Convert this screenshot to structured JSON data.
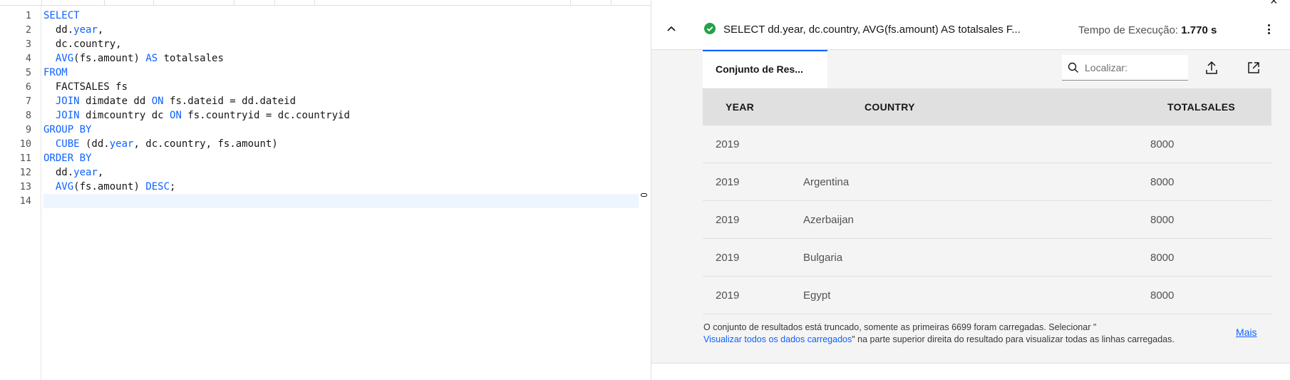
{
  "editor": {
    "line_numbers": [
      "1",
      "2",
      "3",
      "4",
      "5",
      "6",
      "7",
      "8",
      "9",
      "10",
      "11",
      "12",
      "13",
      "14"
    ],
    "lines": [
      [
        {
          "t": "SELECT",
          "k": "kw"
        }
      ],
      [
        {
          "t": "  dd.",
          "k": "id"
        },
        {
          "t": "year",
          "k": "kw"
        },
        {
          "t": ",",
          "k": "id"
        }
      ],
      [
        {
          "t": "  dc.country,",
          "k": "id"
        }
      ],
      [
        {
          "t": "  ",
          "k": "id"
        },
        {
          "t": "AVG",
          "k": "kw"
        },
        {
          "t": "(fs.amount) ",
          "k": "id"
        },
        {
          "t": "AS",
          "k": "kw"
        },
        {
          "t": " totalsales",
          "k": "id"
        }
      ],
      [
        {
          "t": "FROM",
          "k": "kw"
        }
      ],
      [
        {
          "t": "  FACTSALES fs",
          "k": "id"
        }
      ],
      [
        {
          "t": "  ",
          "k": "id"
        },
        {
          "t": "JOIN",
          "k": "kw"
        },
        {
          "t": " dimdate dd ",
          "k": "id"
        },
        {
          "t": "ON",
          "k": "kw"
        },
        {
          "t": " fs.dateid = dd.dateid",
          "k": "id"
        }
      ],
      [
        {
          "t": "  ",
          "k": "id"
        },
        {
          "t": "JOIN",
          "k": "kw"
        },
        {
          "t": " dimcountry dc ",
          "k": "id"
        },
        {
          "t": "ON",
          "k": "kw"
        },
        {
          "t": " fs.countryid = dc.countryid",
          "k": "id"
        }
      ],
      [
        {
          "t": "GROUP BY",
          "k": "kw"
        }
      ],
      [
        {
          "t": "  ",
          "k": "id"
        },
        {
          "t": "CUBE",
          "k": "kw"
        },
        {
          "t": " (dd.",
          "k": "id"
        },
        {
          "t": "year",
          "k": "kw"
        },
        {
          "t": ", dc.country, fs.amount)",
          "k": "id"
        }
      ],
      [
        {
          "t": "ORDER BY",
          "k": "kw"
        }
      ],
      [
        {
          "t": "  dd.",
          "k": "id"
        },
        {
          "t": "year",
          "k": "kw"
        },
        {
          "t": ",",
          "k": "id"
        }
      ],
      [
        {
          "t": "  ",
          "k": "id"
        },
        {
          "t": "AVG",
          "k": "kw"
        },
        {
          "t": "(fs.amount) ",
          "k": "id"
        },
        {
          "t": "DESC",
          "k": "kw"
        },
        {
          "t": ";",
          "k": "id"
        }
      ],
      []
    ]
  },
  "results": {
    "query_summary": "SELECT dd.year, dc.country, AVG(fs.amount) AS totalsales F...",
    "exec_time_label": "Tempo de Execução:",
    "exec_time_value": "1.770 s",
    "close_glyph": "×",
    "tab_label": "Conjunto de Res...",
    "search_placeholder": "Localizar:",
    "columns": [
      "YEAR",
      "COUNTRY",
      "TOTALSALES"
    ],
    "rows": [
      [
        "2019",
        "",
        "8000"
      ],
      [
        "2019",
        "Argentina",
        "8000"
      ],
      [
        "2019",
        "Azerbaijan",
        "8000"
      ],
      [
        "2019",
        "Bulgaria",
        "8000"
      ],
      [
        "2019",
        "Egypt",
        "8000"
      ]
    ],
    "truncation_text_1": "O conjunto de resultados está truncado, somente as primeiras 6699 foram carregadas. Selecionar \"",
    "truncation_link": "Visualizar todos os dados carregados",
    "truncation_text_2": "\" na parte superior direita do resultado para visualizar todas as linhas carregadas.",
    "more_label": "Mais"
  },
  "colors": {
    "keyword": "#0f62fe",
    "success": "#24a148",
    "link": "#0f62fe",
    "current_line": "#edf5ff"
  },
  "icons": [
    "chevron-up-icon",
    "success-check-icon",
    "overflow-menu-icon",
    "search-icon",
    "export-icon",
    "launch-icon",
    "close-icon"
  ]
}
